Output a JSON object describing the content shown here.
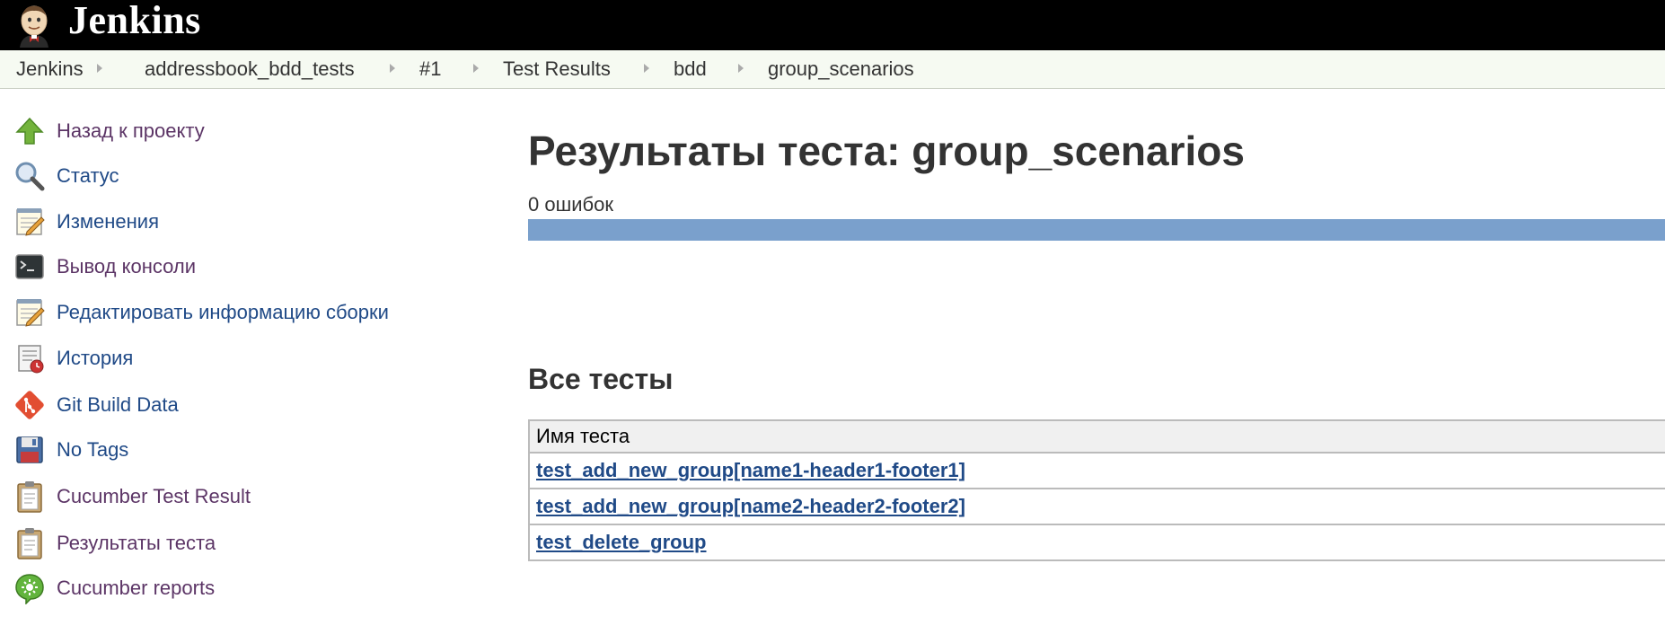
{
  "header": {
    "logo_text": "Jenkins",
    "logo_icon": "jenkins-butler-icon",
    "background_color": "#000000"
  },
  "breadcrumbs": [
    {
      "label": "Jenkins"
    },
    {
      "label": "addressbook_bdd_tests"
    },
    {
      "label": "#1"
    },
    {
      "label": "Test Results"
    },
    {
      "label": "bdd"
    },
    {
      "label": "group_scenarios"
    }
  ],
  "side_panel": {
    "tasks": [
      {
        "label": "Назад к проекту",
        "icon": "up-arrow-icon",
        "visited": true
      },
      {
        "label": "Статус",
        "icon": "magnifier-icon",
        "visited": false
      },
      {
        "label": "Изменения",
        "icon": "notepad-icon",
        "visited": false
      },
      {
        "label": "Вывод консоли",
        "icon": "terminal-icon",
        "visited": true
      },
      {
        "label": "Редактировать информацию сборки",
        "icon": "notepad-icon",
        "visited": false
      },
      {
        "label": "История",
        "icon": "history-icon",
        "visited": false
      },
      {
        "label": "Git Build Data",
        "icon": "git-icon",
        "visited": false
      },
      {
        "label": "No Tags",
        "icon": "floppy-disk-icon",
        "visited": false
      },
      {
        "label": "Cucumber Test Result",
        "icon": "clipboard-icon",
        "visited": true
      },
      {
        "label": "Результаты теста",
        "icon": "clipboard-icon",
        "visited": true
      },
      {
        "label": "Cucumber reports",
        "icon": "cucumber-icon",
        "visited": true
      }
    ]
  },
  "main": {
    "title": "Результаты теста: group_scenarios",
    "fail_count": "0 ошибок",
    "pass_fraction": 1.0,
    "all_tests_heading": "Все тесты",
    "table": {
      "column_header": "Имя теста",
      "rows": [
        {
          "name": "test_add_new_group[name1-header1-footer1]"
        },
        {
          "name": "test_add_new_group[name2-header2-footer2]"
        },
        {
          "name": "test_delete_group"
        }
      ]
    }
  },
  "colors": {
    "link": "#204a87",
    "visited_link": "#5c3566",
    "progress_pass": "#7aa0cc",
    "breadcrumb_bg": "#f6faf2"
  }
}
